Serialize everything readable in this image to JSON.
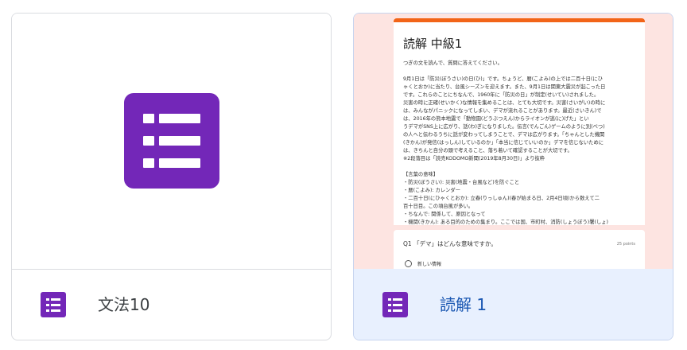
{
  "cards": [
    {
      "title": "文法10",
      "icon": "forms-list-icon"
    },
    {
      "title": "読解 1",
      "icon": "forms-list-icon",
      "preview": {
        "heading": "読解 中級1",
        "lines": [
          "つぎの文を読んで、質問に答えてください。",
          "",
          "9月1日は「防災(ぼうさい)の日(ひ)」です。ちょうど、暦(こよみ)の上では二百十日(にひ",
          "ゃくとおか)に当たり、台風シーズンを迎えます。また、9月1日は関東大震災が起こった日",
          "です。これらのことにちなんで、1960年に「防災の日」が制定(せいてい)されました。",
          "災害の時に正確(せいかく)な情報を集めることは、とても大切です。災害(さいがい)の時に",
          "は、みんながパニックになってしまい、デマが流れることがあります。最近(さいきん)で",
          "は、2016年の熊本地震で「動物園(どうぶつえん)からライオンが逃(に)げた」とい",
          "うデマがSNS上に広がり、話(わ)ぎになりました。伝言(でんごん)ゲームのように別(べつ)",
          "の人へと伝わるうちに話が変わってしまうことで、デマは広がります。「ちゃんとした機関",
          "(きかん)が発信(はっしん)しているのか」「本当に信じていいのか」デマを信じないために",
          "は、きちんと自分の頭で考えること、落ち着いて確認することが大切です。",
          "※2段落目は「読売KODOMO新聞(2019年8月30日)」より抜粋",
          "",
          "【言葉の意味】",
          "・防災(ぼうさい): 災害(地震・台風など)を防ぐこと",
          "・暦(こよみ): カレンダー",
          "・二百十日(にひゃくとおか): 立春(りっしゅん)(春が始まる日、2月4日頃)から数えて二",
          "百十日目。この頃台風が多い。",
          "・ちなんで: 関係して、原因となって",
          "・機関(きかん): ある目的のための集まり。ここでは国、市町村、消防(しょうぼう)署(しょ)"
        ],
        "question": "Q1 「デマ」はどんな意味ですか。",
        "points": "25 points",
        "option": "新しい情報"
      }
    }
  ]
}
